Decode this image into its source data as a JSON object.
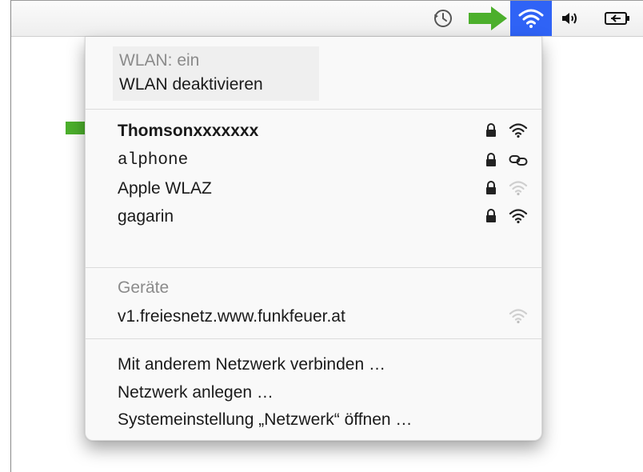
{
  "menubar": {
    "icons": [
      "time-machine-icon",
      "wifi-icon",
      "volume-icon",
      "battery-icon"
    ],
    "highlight_color": "#2f63f6"
  },
  "annotation": {
    "arrow_color": "#4caf2c"
  },
  "wifi_menu": {
    "status": "WLAN: ein",
    "toggle_label": "WLAN deaktivieren",
    "networks": [
      {
        "name": "Thomsonxxxxxxx",
        "locked": true,
        "signal_icon": "wifi-signal-icon",
        "selected": true
      },
      {
        "name": "alphone",
        "locked": true,
        "signal_icon": "chain-link-icon"
      },
      {
        "name": "Apple WLAZ",
        "locked": true,
        "signal_icon": "wifi-signal-weak-icon"
      },
      {
        "name": "gagarin",
        "locked": true,
        "signal_icon": "wifi-signal-icon"
      }
    ],
    "devices_header": "Geräte",
    "devices": [
      {
        "name": "v1.freiesnetz.www.funkfeuer.at",
        "signal_icon": "wifi-signal-weak-icon"
      }
    ],
    "actions": [
      "Mit anderem Netzwerk verbinden …",
      "Netzwerk anlegen …",
      "Systemeinstellung „Netzwerk“ öffnen …"
    ]
  }
}
